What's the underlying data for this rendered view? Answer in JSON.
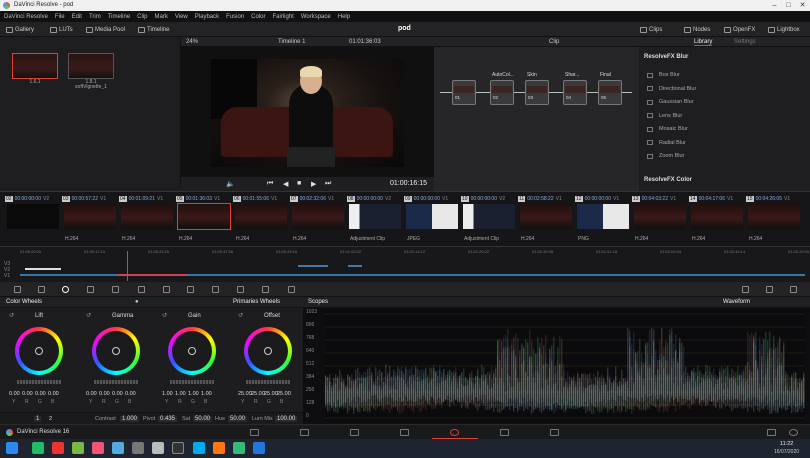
{
  "window": {
    "title": "DaVinci Resolve - pod"
  },
  "menubar": [
    "DaVinci Resolve",
    "File",
    "Edit",
    "Trim",
    "Timeline",
    "Clip",
    "Mark",
    "View",
    "Playback",
    "Fusion",
    "Color",
    "Fairlight",
    "Workspace",
    "Help"
  ],
  "toolbar": {
    "gallery": "Gallery",
    "luts": "LUTs",
    "media_pool": "Media Pool",
    "timeline": "Timeline",
    "page_title": "pod",
    "clips": "Clips",
    "nodes": "Nodes",
    "openfx": "OpenFX",
    "lightbox": "Lightbox"
  },
  "gallery": {
    "stills": [
      {
        "label": "1.6.1"
      },
      {
        "label": "1.8.1\nsoftVignette_1"
      }
    ]
  },
  "viewer": {
    "zoom": "24%",
    "timeline_name": "Timeline 1",
    "timecode_top": "01:01:36:03",
    "timecode": "01:00:16:15"
  },
  "nodes": {
    "mode": "Clip",
    "items": [
      {
        "id": "01",
        "label": ""
      },
      {
        "id": "02",
        "label": "AutoCol..."
      },
      {
        "id": "03",
        "label": "Skin"
      },
      {
        "id": "04",
        "label": "Shar..."
      },
      {
        "id": "05",
        "label": "Final"
      }
    ]
  },
  "library": {
    "tabs": [
      "Library",
      "Settings"
    ],
    "section1": "ResolveFX Blur",
    "items": [
      "Box Blur",
      "Directional Blur",
      "Gaussian Blur",
      "Lens Blur",
      "Mosaic Blur",
      "Radial Blur",
      "Zoom Blur"
    ],
    "section2": "ResolveFX Color"
  },
  "clips": [
    {
      "num": "02",
      "tc": "00:00:00:00",
      "track": "V2",
      "codec": "",
      "dark": true
    },
    {
      "num": "03",
      "tc": "00:00:57:22",
      "track": "V1",
      "codec": "H.264"
    },
    {
      "num": "04",
      "tc": "00:01:09:21",
      "track": "V1",
      "codec": "H.264"
    },
    {
      "num": "05",
      "tc": "00:01:36:03",
      "track": "V1",
      "codec": "H.264",
      "selected": true
    },
    {
      "num": "06",
      "tc": "00:01:55:06",
      "track": "V1",
      "codec": "H.264"
    },
    {
      "num": "07",
      "tc": "00:02:32:06",
      "track": "V1",
      "codec": "H.264"
    },
    {
      "num": "08",
      "tc": "00:00:00:00",
      "track": "V2",
      "codec": "Adjustment Clip"
    },
    {
      "num": "09",
      "tc": "00:00:00:00",
      "track": "V1",
      "codec": "JPEG"
    },
    {
      "num": "10",
      "tc": "00:00:00:00",
      "track": "V2",
      "codec": "Adjustment Clip"
    },
    {
      "num": "11",
      "tc": "00:02:58:22",
      "track": "V1",
      "codec": "H.264"
    },
    {
      "num": "12",
      "tc": "00:00:00:00",
      "track": "V1",
      "codec": "PNG"
    },
    {
      "num": "13",
      "tc": "00:04:03:22",
      "track": "V1",
      "codec": "H.264"
    },
    {
      "num": "14",
      "tc": "00:04:17:06",
      "track": "V1",
      "codec": "H.264"
    },
    {
      "num": "15",
      "tc": "00:04:26:05",
      "track": "V1",
      "codec": "H.264"
    }
  ],
  "mini_timeline": {
    "tracks": [
      "V3",
      "V2",
      "V1"
    ],
    "ticks": [
      "01:00:00:00",
      "01:00:12:10",
      "01:00:24:20",
      "01:00:37:06",
      "01:00:49:16",
      "01:01:02:02",
      "01:01:14:12",
      "01:01:26:22",
      "01:01:39:08",
      "01:01:51:18",
      "01:02:04:04",
      "01:02:16:14",
      "01:02:29:00"
    ]
  },
  "color_wheels": {
    "title": "Color Wheels",
    "mode": "Primaries Wheels",
    "wheels": [
      {
        "name": "Lift",
        "vals": [
          "0.00",
          "0.00",
          "0.00",
          "0.00"
        ]
      },
      {
        "name": "Gamma",
        "vals": [
          "0.00",
          "0.00",
          "0.00",
          "0.00"
        ]
      },
      {
        "name": "Gain",
        "vals": [
          "1.00",
          "1.00",
          "1.00",
          "1.00"
        ]
      },
      {
        "name": "Offset",
        "vals": [
          "25.00",
          "25.00",
          "25.00",
          "25.00"
        ]
      }
    ],
    "channels": [
      "Y",
      "R",
      "G",
      "B"
    ],
    "footer": {
      "page1": "1",
      "page2": "2",
      "contrast_label": "Contrast",
      "contrast": "1.000",
      "pivot_label": "Pivot",
      "pivot": "0.435",
      "sat_label": "Sat",
      "sat": "50.00",
      "hue_label": "Hue",
      "hue": "50.00",
      "lummix_label": "Lum Mix",
      "lummix": "100.00"
    }
  },
  "scopes": {
    "title": "Scopes",
    "mode": "Waveform",
    "ylabels": [
      "1023",
      "896",
      "768",
      "640",
      "512",
      "384",
      "256",
      "128",
      "0"
    ]
  },
  "pagebar": {
    "app": "DaVinci Resolve 16"
  },
  "taskbar": {
    "time": "11:22",
    "date": "16/07/2020"
  }
}
